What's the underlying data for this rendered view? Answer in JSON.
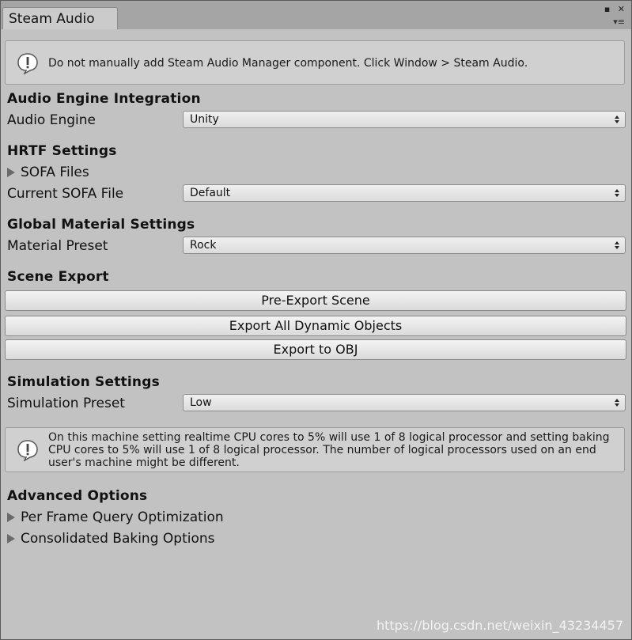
{
  "window": {
    "tab_title": "Steam Audio",
    "maximize_glyph": "▪",
    "close_glyph": "✕",
    "menu_glyph": "▾≡"
  },
  "help_top": {
    "message": "Do not manually add Steam Audio Manager component. Click Window > Steam Audio."
  },
  "audio_engine_integration": {
    "header": "Audio Engine Integration",
    "audio_engine_label": "Audio Engine",
    "audio_engine_value": "Unity"
  },
  "hrtf": {
    "header": "HRTF Settings",
    "sofa_files_label": "SOFA Files",
    "current_sofa_label": "Current SOFA File",
    "current_sofa_value": "Default"
  },
  "global_material": {
    "header": "Global Material Settings",
    "material_preset_label": "Material Preset",
    "material_preset_value": "Rock"
  },
  "scene_export": {
    "header": "Scene Export",
    "pre_export_label": "Pre-Export Scene",
    "export_dynamic_label": "Export All Dynamic Objects",
    "export_obj_label": "Export to OBJ"
  },
  "simulation": {
    "header": "Simulation Settings",
    "preset_label": "Simulation Preset",
    "preset_value": "Low"
  },
  "help_cpu": {
    "line1": "On this machine setting realtime CPU cores to 5% will use 1 of 8 logical processor and setting baking",
    "line2": "CPU cores to 5% will use 1 of 8 logical processor. The number of logical processors used on an end",
    "line3": "user's machine might be different."
  },
  "advanced": {
    "header": "Advanced Options",
    "per_frame_label": "Per Frame Query Optimization",
    "consolidated_label": "Consolidated Baking Options"
  },
  "watermark": "https://blog.csdn.net/weixin_43234457",
  "colors": {
    "panel_bg": "#c2c2c2",
    "tabbar_bg": "#a5a5a5",
    "helpbox_bg": "#d0d0d0"
  }
}
